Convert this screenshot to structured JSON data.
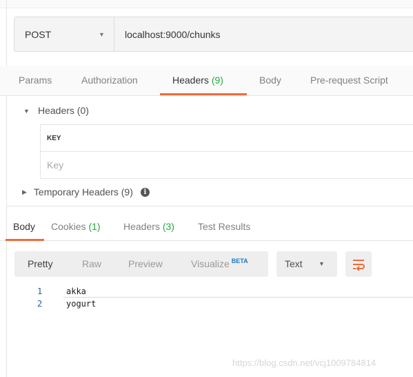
{
  "request": {
    "method": "POST",
    "url": "localhost:9000/chunks"
  },
  "request_tabs": {
    "params": "Params",
    "authorization": "Authorization",
    "headers_label": "Headers",
    "headers_count": "(9)",
    "body": "Body",
    "prerequest": "Pre-request Script"
  },
  "headers_section": {
    "title": "Headers (0)",
    "column_key": "KEY",
    "key_placeholder": "Key",
    "temporary_headers": "Temporary Headers (9)"
  },
  "response_tabs": {
    "body": "Body",
    "cookies_label": "Cookies",
    "cookies_count": "(1)",
    "headers_label": "Headers",
    "headers_count": "(3)",
    "test_results": "Test Results"
  },
  "view_options": {
    "pretty": "Pretty",
    "raw": "Raw",
    "preview": "Preview",
    "visualize": "Visualize",
    "beta": "BETA",
    "format": "Text"
  },
  "response_body": {
    "lines": [
      {
        "number": "1",
        "text": "akka"
      },
      {
        "number": "2",
        "text": "yogurt"
      }
    ]
  },
  "watermark": "https://blog.csdn.net/vcj1009784814",
  "colors": {
    "accent": "#f26b3a",
    "count_green": "#26a641",
    "beta_blue": "#1a78c2"
  }
}
